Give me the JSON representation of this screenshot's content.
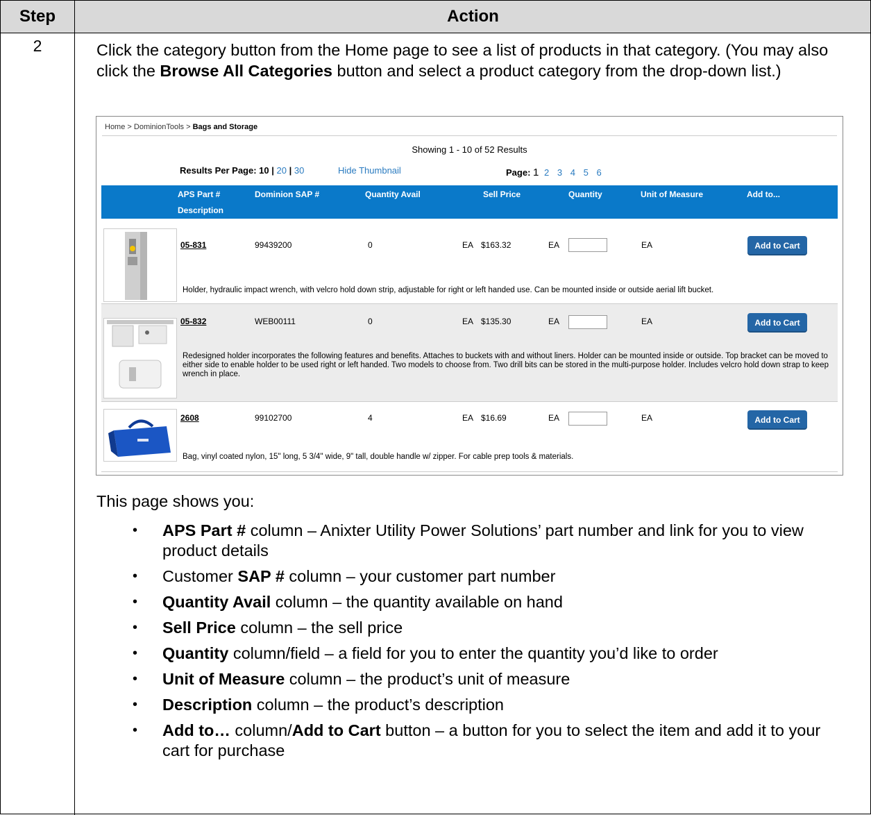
{
  "table": {
    "header_step": "Step",
    "header_action": "Action",
    "step_number": "2"
  },
  "intro": {
    "part1": "Click the category button from the Home page to see a list of products in that category. (You may also click the ",
    "bold": "Browse All Categories",
    "part2": " button and select a product category from the drop-down list.)"
  },
  "screenshot": {
    "breadcrumb": {
      "home": "Home",
      "sep": " > ",
      "level1": "DominionTools",
      "current": "Bags and Storage"
    },
    "showing": "Showing 1 - 10 of 52 Results",
    "results_per_page_label": "Results Per Page:",
    "per_page_options": [
      "10",
      "20",
      "30"
    ],
    "hide_thumbnail": "Hide Thumbnail",
    "page_label": "Page:",
    "pages": [
      "1",
      "2",
      "3",
      "4",
      "5",
      "6"
    ],
    "columns": {
      "aps_part": "APS Part #",
      "description": "Description",
      "sap": "Dominion SAP #",
      "qty_avail": "Quantity Avail",
      "sell_price": "Sell Price",
      "quantity": "Quantity",
      "uom": "Unit of Measure",
      "add_to": "Add to..."
    },
    "add_to_cart": "Add to Cart",
    "rows": [
      {
        "part": "05-831",
        "sap": "99439200",
        "avail": "0",
        "price_uom": "EA",
        "price": "$163.32",
        "qty_uom": "EA",
        "uom": "EA",
        "description": "Holder, hydraulic impact wrench, with velcro hold down strip, adjustable for right or left handed use. Can be mounted inside or outside aerial lift bucket."
      },
      {
        "part": "05-832",
        "sap": "WEB00111",
        "avail": "0",
        "price_uom": "EA",
        "price": "$135.30",
        "qty_uom": "EA",
        "uom": "EA",
        "description": "Redesigned holder incorporates the following features and benefits. Attaches to buckets with and without liners. Holder can be mounted inside or outside. Top bracket can be moved to either side to enable holder to be used right or left handed. Two models to choose from. Two drill bits can be stored in the multi-purpose holder. Includes velcro hold down strap to keep wrench in place."
      },
      {
        "part": "2608",
        "sap": "99102700",
        "avail": "4",
        "price_uom": "EA",
        "price": "$16.69",
        "qty_uom": "EA",
        "uom": "EA",
        "description": "Bag, vinyl coated nylon, 15\" long, 5 3/4\" wide, 9\" tall, double handle w/ zipper. For cable prep tools & materials."
      }
    ]
  },
  "shows_heading": "This page shows you:",
  "bullets": [
    {
      "bold": "APS Part #",
      "prefix": "",
      "rest": " column – Anixter Utility Power Solutions’ part number and link for you to view product details"
    },
    {
      "bold": "SAP #",
      "prefix": "Customer ",
      "rest": " column – your customer part number"
    },
    {
      "bold": "Quantity Avail",
      "prefix": "",
      "rest": " column – the quantity available on hand"
    },
    {
      "bold": "Sell Price",
      "prefix": "",
      "rest": " column – the sell price"
    },
    {
      "bold": "Quantity",
      "prefix": "",
      "rest": " column/field – a field for you to enter the quantity you’d like to order"
    },
    {
      "bold": "Unit of Measure",
      "prefix": "",
      "rest": " column – the product’s unit of measure"
    },
    {
      "bold": "Description",
      "prefix": "",
      "rest": " column – the product’s description"
    },
    {
      "bold": "Add to…",
      "prefix": "",
      "mid": " column/",
      "bold2": "Add to Cart",
      "rest": " button – a button for you to select the item and add it to your cart for purchase"
    }
  ],
  "colors": {
    "header_gray": "#d9d9d9",
    "table_header_blue": "#0a79c9",
    "link_blue": "#2a7bc0",
    "button_blue": "#2466a6"
  }
}
